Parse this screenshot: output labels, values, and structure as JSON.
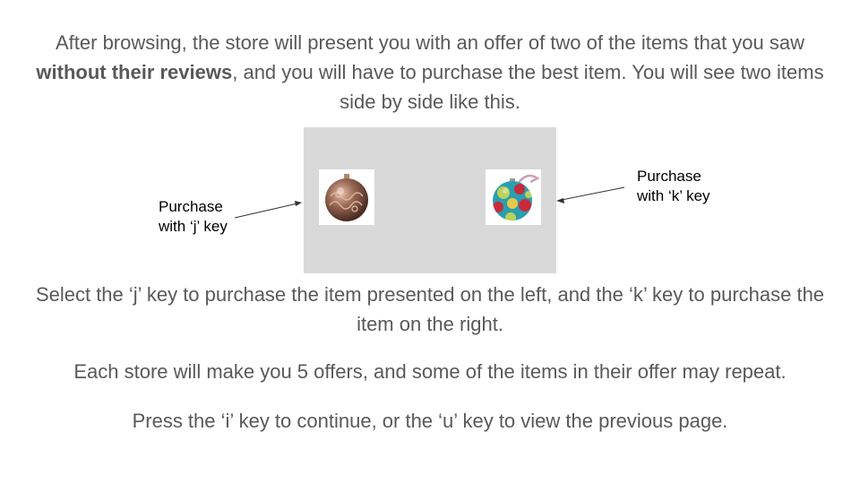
{
  "intro": {
    "part1": "After browsing, the store will present you with an offer of two of the items that you saw ",
    "bold": "without their reviews",
    "part2": ", and you will have to purchase the best item. You will see two items side by side like this."
  },
  "items": {
    "left": {
      "icon": "bronze-ornament-icon"
    },
    "right": {
      "icon": "polka-dot-ornament-icon"
    }
  },
  "labels": {
    "left_line1": "Purchase",
    "left_line2": "with ‘j’ key",
    "right_line1": "Purchase",
    "right_line2": "with ‘k’ key"
  },
  "instruction_select": "Select the ‘j’ key to purchase the item presented on the left, and the ‘k’ key to purchase the item on the right.",
  "instruction_offers": "Each store will make you 5 offers, and some of the items in their offer may repeat.",
  "instruction_continue": "Press the ‘i’ key to continue, or the ‘u’ key to view the previous page.",
  "colors": {
    "text": "#595959",
    "panel": "#d9d9d9",
    "label": "#000000"
  }
}
